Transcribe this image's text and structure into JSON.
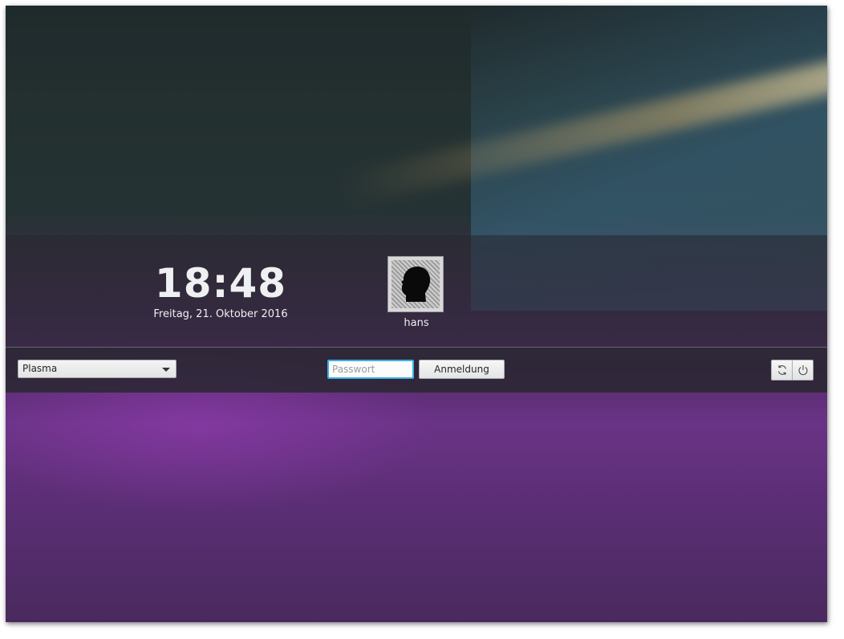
{
  "clock": {
    "time": "18:48",
    "date": "Freitag, 21. Oktober 2016"
  },
  "user": {
    "name": "hans",
    "avatar_icon": "person-silhouette-icon"
  },
  "session": {
    "selected": "Plasma"
  },
  "password": {
    "placeholder": "Passwort",
    "value": ""
  },
  "login_button": {
    "label": "Anmeldung"
  },
  "power": {
    "reboot_icon": "reboot-icon",
    "shutdown_icon": "shutdown-icon"
  },
  "colors": {
    "accent": "#3daee9",
    "text_light": "#eff0f1"
  }
}
